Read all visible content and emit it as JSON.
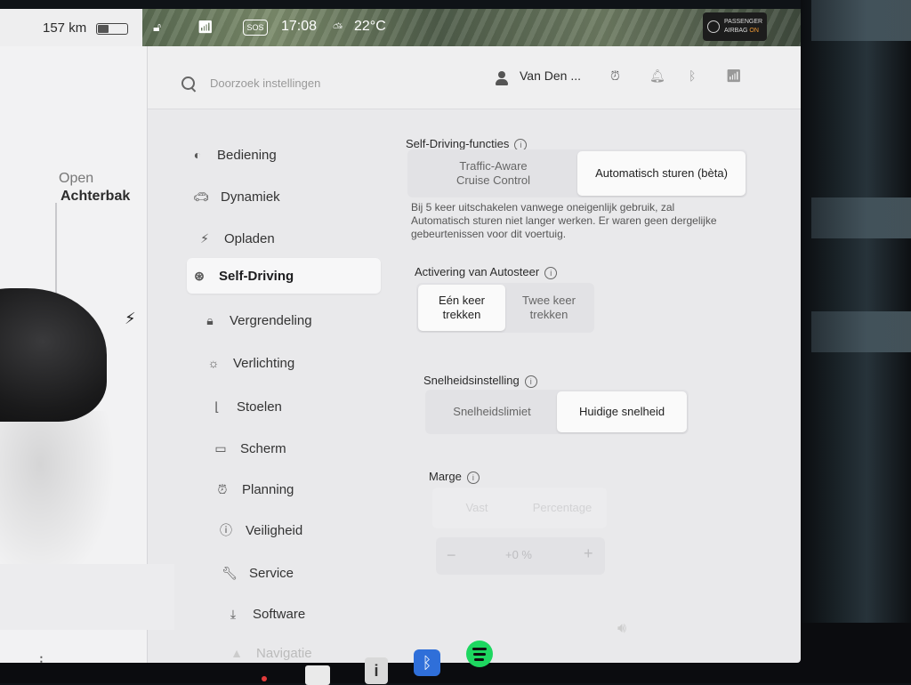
{
  "status": {
    "range": "157 km",
    "battery_level": 0.35,
    "time": "17:08",
    "temperature": "22°C",
    "sos": "SOS",
    "airbag_line1": "PASSENGER",
    "airbag_line2": "AIRBAG",
    "airbag_state": "ON"
  },
  "car": {
    "trunk_status": "Open",
    "trunk_label": "Achterbak"
  },
  "header": {
    "search_placeholder": "Doorzoek instellingen",
    "user_name": "Van Den ..."
  },
  "nav": {
    "items": [
      {
        "label": "Bediening",
        "icon": "toggle-icon"
      },
      {
        "label": "Dynamiek",
        "icon": "car-icon"
      },
      {
        "label": "Opladen",
        "icon": "bolt-icon"
      },
      {
        "label": "Self-Driving",
        "icon": "steering-wheel-icon",
        "active": true
      },
      {
        "label": "Vergrendeling",
        "icon": "lock-icon"
      },
      {
        "label": "Verlichting",
        "icon": "sun-icon"
      },
      {
        "label": "Stoelen",
        "icon": "seat-icon"
      },
      {
        "label": "Scherm",
        "icon": "display-icon"
      },
      {
        "label": "Planning",
        "icon": "alarm-clock-icon"
      },
      {
        "label": "Veiligheid",
        "icon": "alert-circle-icon"
      },
      {
        "label": "Service",
        "icon": "wrench-icon"
      },
      {
        "label": "Software",
        "icon": "download-icon"
      },
      {
        "label": "Navigatie",
        "icon": "navigation-arrow-icon"
      }
    ]
  },
  "content": {
    "self_driving": {
      "title": "Self-Driving-functies",
      "option_a_line1": "Traffic-Aware",
      "option_a_line2": "Cruise Control",
      "option_b": "Automatisch sturen (bèta)",
      "selected": "option_b",
      "note_line1": "Bij 5 keer uitschakelen vanwege oneigenlijk gebruik, zal",
      "note_line2": "Automatisch sturen niet langer werken. Er waren geen dergelijke",
      "note_line3": "gebeurtenissen voor dit voertuig."
    },
    "activation": {
      "title": "Activering van Autosteer",
      "option_a_line1": "Eén keer",
      "option_a_line2": "trekken",
      "option_b_line1": "Twee keer",
      "option_b_line2": "trekken",
      "selected": "option_a"
    },
    "speed": {
      "title": "Snelheidsinstelling",
      "option_a": "Snelheidslimiet",
      "option_b": "Huidige snelheid",
      "selected": "option_b"
    },
    "margin": {
      "title": "Marge",
      "option_a": "Vast",
      "option_b": "Percentage",
      "minus": "−",
      "value": "+0 %",
      "plus": "+"
    }
  }
}
